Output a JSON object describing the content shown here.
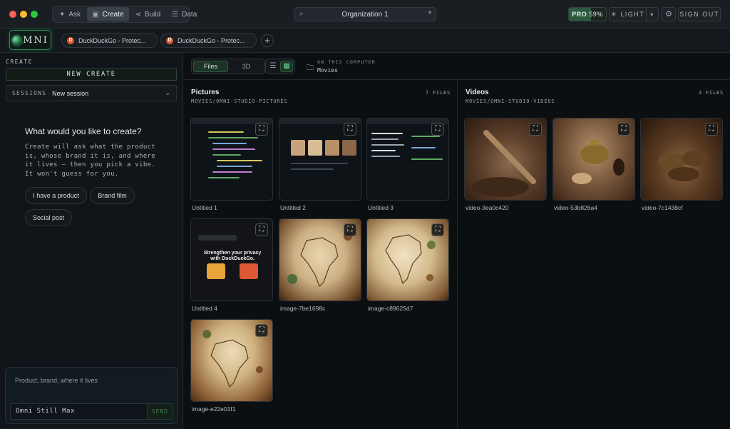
{
  "titlebar": {
    "nav": [
      {
        "label": "Ask",
        "icon": "sparkle-icon"
      },
      {
        "label": "Create",
        "icon": "image-icon",
        "active": true
      },
      {
        "label": "Build",
        "icon": "share-icon"
      },
      {
        "label": "Data",
        "icon": "database-icon"
      }
    ],
    "org": "Organization 1",
    "plan": {
      "label": "PRO",
      "usage": "59%",
      "usage_fraction": 0.59
    },
    "theme": "☀ LIGHT",
    "signout": "SIGN OUT"
  },
  "tabs": {
    "logo": "MNI",
    "items": [
      {
        "label": "DuckDuckGo - Protec..."
      },
      {
        "label": "DuckDuckGo - Protec..."
      }
    ],
    "add": "+"
  },
  "left": {
    "section": "CREATE",
    "new_create": "NEW CREATE",
    "sessions_label": "SESSIONS",
    "sessions_value": "New session",
    "title": "What would you like to create?",
    "description": "Create will ask what the product is, whose brand it is, and where it lives — then you pick a vibe. It won't guess for you.",
    "chips": [
      "I have a product",
      "Brand film",
      "Social post"
    ],
    "composer": {
      "placeholder": "Product, brand, where it lives",
      "model": "Omni Still Max",
      "send": "SEND"
    }
  },
  "toolbar": {
    "modes": [
      "Files",
      "3D"
    ],
    "active_mode": "Files",
    "location_label": "ON THIS COMPUTER",
    "location_value": "Movies"
  },
  "pictures": {
    "title": "Pictures",
    "path": "MOVIES/OMNI-STUDIO-PICTURES",
    "count": "7 FILES",
    "items": [
      {
        "name": "Untitled 1"
      },
      {
        "name": "Untitled 2"
      },
      {
        "name": "Untitled 3"
      },
      {
        "name": "Untitled 4",
        "headline": "Strengthen your privacy with DuckDuckGo."
      },
      {
        "name": "image-7be1698c"
      },
      {
        "name": "image-c89625d7"
      },
      {
        "name": "image-e22e01f1"
      }
    ]
  },
  "videos": {
    "title": "Videos",
    "path": "MOVIES/OMNI-STUDIO-VIDEOS",
    "count": "3 FILES",
    "items": [
      {
        "name": "video-3ea0c420"
      },
      {
        "name": "video-53b826a4"
      },
      {
        "name": "video-7c1438cf"
      }
    ]
  },
  "colors": {
    "accent": "#2c8a55",
    "background": "#0c0f12",
    "panel": "#111418"
  }
}
